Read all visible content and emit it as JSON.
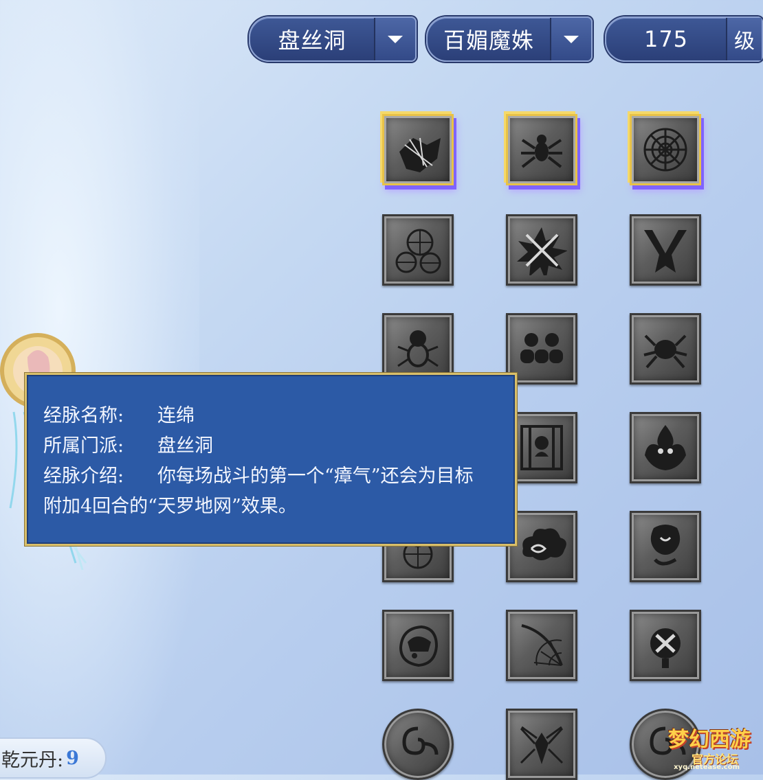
{
  "dropdowns": {
    "sect": {
      "value": "盘丝洞"
    },
    "role": {
      "value": "百媚魔姝"
    },
    "level": {
      "value": "175",
      "unit": "级"
    }
  },
  "skills": [
    {
      "name": "flying-web-insect",
      "active": true
    },
    {
      "name": "spider",
      "active": true
    },
    {
      "name": "spider-web",
      "active": true
    },
    {
      "name": "multi-web",
      "active": false
    },
    {
      "name": "crossed-blades",
      "active": false
    },
    {
      "name": "bone-spikes",
      "active": false
    },
    {
      "name": "blood-spider",
      "active": false
    },
    {
      "name": "skull-row",
      "active": false
    },
    {
      "name": "dark-spider",
      "active": false
    },
    {
      "name": "hidden-web",
      "active": false
    },
    {
      "name": "caged-face",
      "active": false
    },
    {
      "name": "flame-demon",
      "active": false
    },
    {
      "name": "web-orb",
      "active": false
    },
    {
      "name": "cloud-swirl",
      "active": false
    },
    {
      "name": "ghost-mask",
      "active": false
    },
    {
      "name": "veiled-woman",
      "active": false
    },
    {
      "name": "corner-web",
      "active": false
    },
    {
      "name": "knotted-sword",
      "active": false
    },
    {
      "name": "swirl-coin",
      "active": false
    },
    {
      "name": "spider-lord",
      "active": false
    },
    {
      "name": "swirl-coin-2",
      "active": false
    }
  ],
  "tooltip": {
    "name_label": "经脉名称:",
    "name_value": "连绵",
    "sect_label": "所属门派:",
    "sect_value": "盘丝洞",
    "desc_label": "经脉介绍:",
    "desc_line1": "你每场战斗的第一个“瘴气”还会为目标",
    "desc_line2": "附加4回合的“天罗地网”效果。"
  },
  "qiandan": {
    "label": "乾元丹:",
    "value": "9"
  },
  "watermark": {
    "title": "梦幻西游",
    "subtitle": "官方论坛",
    "url": "xyq.netease.com"
  }
}
